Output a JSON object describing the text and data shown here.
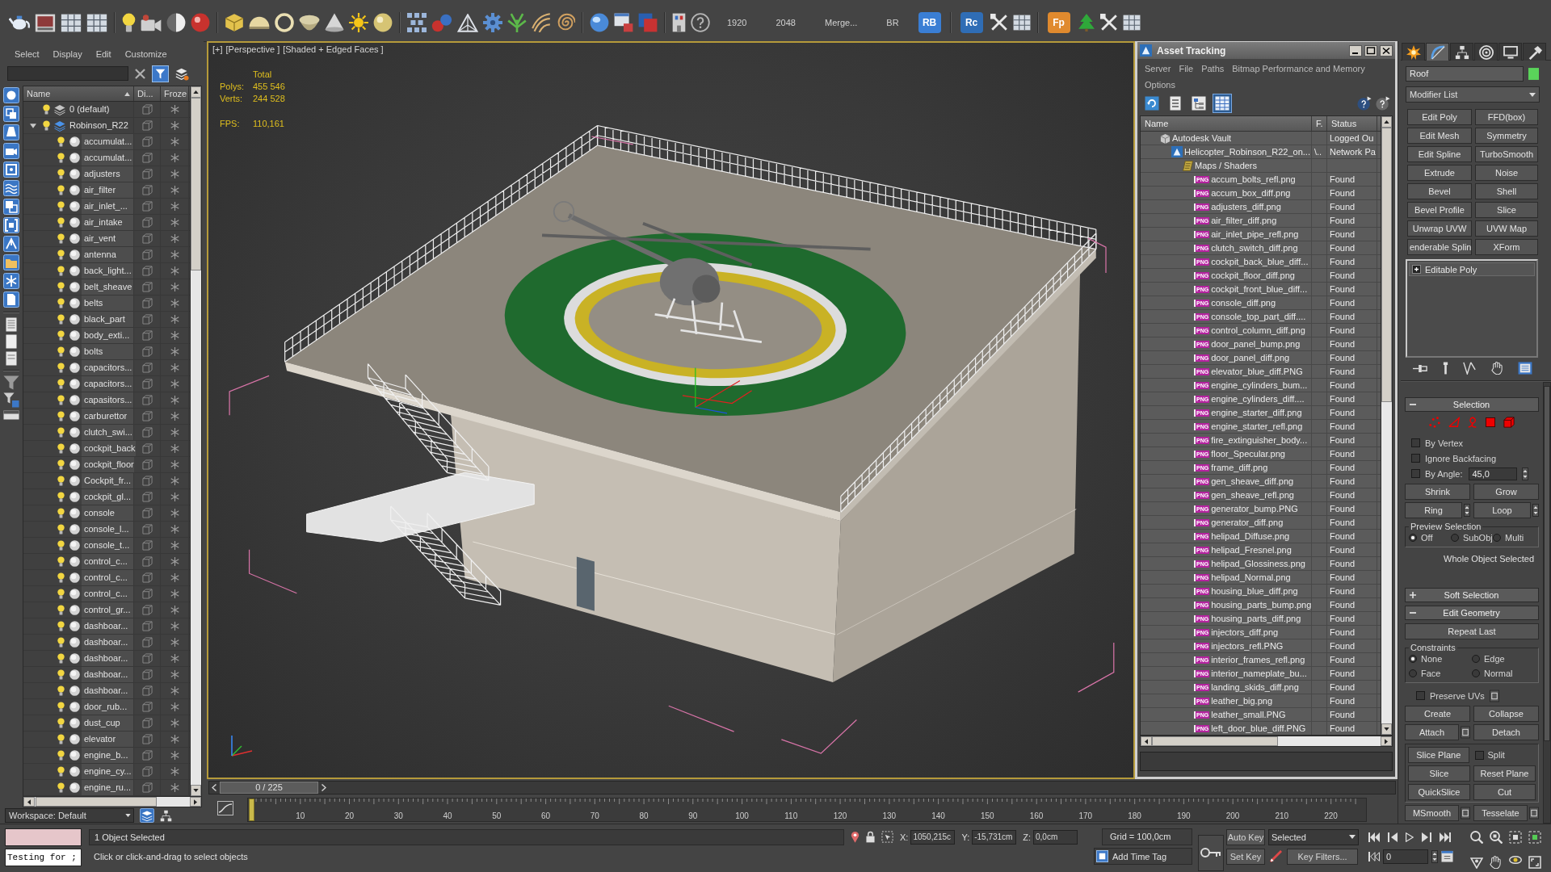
{
  "toolbar": {
    "buttons": [
      {
        "label": "1920",
        "kind": "text"
      },
      {
        "label": "2048",
        "kind": "text"
      },
      {
        "label": "Merge...",
        "kind": "text"
      },
      {
        "label": "BR",
        "kind": "text"
      },
      {
        "label": "RB",
        "kind": "tile",
        "color": "#3a7ed4"
      },
      {
        "label": "Rc",
        "kind": "tile",
        "color": "#2f6db5"
      },
      {
        "label": "Fp",
        "kind": "tile",
        "color": "#e08a2e"
      }
    ]
  },
  "scene_explorer": {
    "menu": [
      "Select",
      "Display",
      "Edit",
      "Customize"
    ],
    "columns": [
      "Name",
      "Di...",
      "Froze"
    ],
    "tree": [
      {
        "name": "0 (default)",
        "kind": "layer",
        "active": false
      },
      {
        "name": "Robinson_R22",
        "kind": "layer",
        "active": true,
        "expanded": true,
        "children": [
          {
            "name": "accumulat...",
            "kind": "object"
          },
          {
            "name": "accumulat...",
            "kind": "object"
          },
          {
            "name": "adjusters",
            "kind": "object"
          },
          {
            "name": "air_filter",
            "kind": "object"
          },
          {
            "name": "air_inlet_...",
            "kind": "object"
          },
          {
            "name": "air_intake",
            "kind": "object"
          },
          {
            "name": "air_vent",
            "kind": "object"
          },
          {
            "name": "antenna",
            "kind": "object"
          },
          {
            "name": "back_light...",
            "kind": "object"
          },
          {
            "name": "belt_sheave",
            "kind": "object"
          },
          {
            "name": "belts",
            "kind": "object"
          },
          {
            "name": "black_part",
            "kind": "object"
          },
          {
            "name": "body_exti...",
            "kind": "object"
          },
          {
            "name": "bolts",
            "kind": "object"
          },
          {
            "name": "capacitors...",
            "kind": "object"
          },
          {
            "name": "capacitors...",
            "kind": "object"
          },
          {
            "name": "capasitors...",
            "kind": "object"
          },
          {
            "name": "carburettor",
            "kind": "object"
          },
          {
            "name": "clutch_swi...",
            "kind": "object"
          },
          {
            "name": "cockpit_back",
            "kind": "object"
          },
          {
            "name": "cockpit_floor",
            "kind": "object"
          },
          {
            "name": "Cockpit_fr...",
            "kind": "object"
          },
          {
            "name": "cockpit_gl...",
            "kind": "object"
          },
          {
            "name": "console",
            "kind": "object"
          },
          {
            "name": "console_l...",
            "kind": "object"
          },
          {
            "name": "console_t...",
            "kind": "object"
          },
          {
            "name": "control_c...",
            "kind": "object"
          },
          {
            "name": "control_c...",
            "kind": "object"
          },
          {
            "name": "control_c...",
            "kind": "object"
          },
          {
            "name": "control_gr...",
            "kind": "object"
          },
          {
            "name": "dashboar...",
            "kind": "object"
          },
          {
            "name": "dashboar...",
            "kind": "object"
          },
          {
            "name": "dashboar...",
            "kind": "object"
          },
          {
            "name": "dashboar...",
            "kind": "object"
          },
          {
            "name": "dashboar...",
            "kind": "object"
          },
          {
            "name": "door_rub...",
            "kind": "object"
          },
          {
            "name": "dust_cup",
            "kind": "object"
          },
          {
            "name": "elevator",
            "kind": "object"
          },
          {
            "name": "engine_b...",
            "kind": "object"
          },
          {
            "name": "engine_cy...",
            "kind": "object"
          },
          {
            "name": "engine_ru...",
            "kind": "object"
          }
        ]
      }
    ],
    "workspace": "Workspace: Default"
  },
  "viewport": {
    "active": true,
    "labels": [
      "[+]",
      "[Perspective ]",
      "[Shaded + Edged Faces ]"
    ],
    "stats": {
      "header": "Total",
      "rows": [
        {
          "label": "Polys:",
          "value": "455 546"
        },
        {
          "label": "Verts:",
          "value": "244 528"
        },
        {
          "label": "FPS:",
          "value": "110,161"
        }
      ]
    }
  },
  "asset_tracking": {
    "title": "Asset Tracking",
    "menu": [
      "Server",
      "File",
      "Paths",
      "Bitmap Performance and Memory",
      "Options"
    ],
    "view_buttons": [
      {
        "selected": false
      },
      {
        "selected": false
      },
      {
        "selected": false
      },
      {
        "selected": true
      }
    ],
    "columns": [
      "Name",
      "F.",
      "Status"
    ],
    "tree": [
      {
        "name": "Autodesk Vault",
        "kind": "vault",
        "status": "Logged Ou",
        "children": [
          {
            "name": "Helicopter_Robinson_R22_on...",
            "kind": "scene",
            "flag": "\\..",
            "status": "Network Pa",
            "children": [
              {
                "name": "Maps / Shaders",
                "kind": "folder",
                "children": [
                  {
                    "name": "accum_bolts_refl.png",
                    "kind": "file",
                    "format": "PNG",
                    "status": "Found"
                  },
                  {
                    "name": "accum_box_diff.png",
                    "kind": "file",
                    "format": "PNG",
                    "status": "Found"
                  },
                  {
                    "name": "adjusters_diff.png",
                    "kind": "file",
                    "format": "PNG",
                    "status": "Found"
                  },
                  {
                    "name": "air_filter_diff.png",
                    "kind": "file",
                    "format": "PNG",
                    "status": "Found"
                  },
                  {
                    "name": "air_inlet_pipe_refl.png",
                    "kind": "file",
                    "format": "PNG",
                    "status": "Found"
                  },
                  {
                    "name": "clutch_switch_diff.png",
                    "kind": "file",
                    "format": "PNG",
                    "status": "Found"
                  },
                  {
                    "name": "cockpit_back_blue_diff...",
                    "kind": "file",
                    "format": "PNG",
                    "status": "Found"
                  },
                  {
                    "name": "cockpit_floor_diff.png",
                    "kind": "file",
                    "format": "PNG",
                    "status": "Found"
                  },
                  {
                    "name": "cockpit_front_blue_diff...",
                    "kind": "file",
                    "format": "PNG",
                    "status": "Found"
                  },
                  {
                    "name": "console_diff.png",
                    "kind": "file",
                    "format": "PNG",
                    "status": "Found"
                  },
                  {
                    "name": "console_top_part_diff....",
                    "kind": "file",
                    "format": "PNG",
                    "status": "Found"
                  },
                  {
                    "name": "control_column_diff.png",
                    "kind": "file",
                    "format": "PNG",
                    "status": "Found"
                  },
                  {
                    "name": "door_panel_bump.png",
                    "kind": "file",
                    "format": "PNG",
                    "status": "Found"
                  },
                  {
                    "name": "door_panel_diff.png",
                    "kind": "file",
                    "format": "PNG",
                    "status": "Found"
                  },
                  {
                    "name": "elevator_blue_diff.PNG",
                    "kind": "file",
                    "format": "PNG",
                    "status": "Found"
                  },
                  {
                    "name": "engine_cylinders_bum...",
                    "kind": "file",
                    "format": "PNG",
                    "status": "Found"
                  },
                  {
                    "name": "engine_cylinders_diff....",
                    "kind": "file",
                    "format": "PNG",
                    "status": "Found"
                  },
                  {
                    "name": "engine_starter_diff.png",
                    "kind": "file",
                    "format": "PNG",
                    "status": "Found"
                  },
                  {
                    "name": "engine_starter_refl.png",
                    "kind": "file",
                    "format": "PNG",
                    "status": "Found"
                  },
                  {
                    "name": "fire_extinguisher_body...",
                    "kind": "file",
                    "format": "PNG",
                    "status": "Found"
                  },
                  {
                    "name": "floor_Specular.png",
                    "kind": "file",
                    "format": "PNG",
                    "status": "Found"
                  },
                  {
                    "name": "frame_diff.png",
                    "kind": "file",
                    "format": "PNG",
                    "status": "Found"
                  },
                  {
                    "name": "gen_sheave_diff.png",
                    "kind": "file",
                    "format": "PNG",
                    "status": "Found"
                  },
                  {
                    "name": "gen_sheave_refl.png",
                    "kind": "file",
                    "format": "PNG",
                    "status": "Found"
                  },
                  {
                    "name": "generator_bump.PNG",
                    "kind": "file",
                    "format": "PNG",
                    "status": "Found"
                  },
                  {
                    "name": "generator_diff.png",
                    "kind": "file",
                    "format": "PNG",
                    "status": "Found"
                  },
                  {
                    "name": "helipad_Diffuse.png",
                    "kind": "file",
                    "format": "PNG",
                    "status": "Found"
                  },
                  {
                    "name": "helipad_Fresnel.png",
                    "kind": "file",
                    "format": "PNG",
                    "status": "Found"
                  },
                  {
                    "name": "helipad_Glossiness.png",
                    "kind": "file",
                    "format": "PNG",
                    "status": "Found"
                  },
                  {
                    "name": "helipad_Normal.png",
                    "kind": "file",
                    "format": "PNG",
                    "status": "Found"
                  },
                  {
                    "name": "housing_blue_diff.png",
                    "kind": "file",
                    "format": "PNG",
                    "status": "Found"
                  },
                  {
                    "name": "housing_parts_bump.png",
                    "kind": "file",
                    "format": "PNG",
                    "status": "Found"
                  },
                  {
                    "name": "housing_parts_diff.png",
                    "kind": "file",
                    "format": "PNG",
                    "status": "Found"
                  },
                  {
                    "name": "injectors_diff.png",
                    "kind": "file",
                    "format": "PNG",
                    "status": "Found"
                  },
                  {
                    "name": "injectors_refl.PNG",
                    "kind": "file",
                    "format": "PNG",
                    "status": "Found"
                  },
                  {
                    "name": "interior_frames_refl.png",
                    "kind": "file",
                    "format": "PNG",
                    "status": "Found"
                  },
                  {
                    "name": "interior_nameplate_bu...",
                    "kind": "file",
                    "format": "PNG",
                    "status": "Found"
                  },
                  {
                    "name": "landing_skids_diff.png",
                    "kind": "file",
                    "format": "PNG",
                    "status": "Found"
                  },
                  {
                    "name": "leather_big.png",
                    "kind": "file",
                    "format": "PNG",
                    "status": "Found"
                  },
                  {
                    "name": "leather_small.PNG",
                    "kind": "file",
                    "format": "PNG",
                    "status": "Found"
                  },
                  {
                    "name": "left_door_blue_diff.PNG",
                    "kind": "file",
                    "format": "PNG",
                    "status": "Found"
                  }
                ]
              }
            ]
          }
        ]
      }
    ]
  },
  "time_slider": {
    "label": "0 / 225",
    "level": 0
  },
  "track_bar": {
    "ticks": [
      "10",
      "20",
      "30",
      "40",
      "50",
      "60",
      "70",
      "80",
      "90",
      "100",
      "110",
      "120",
      "130",
      "140",
      "150",
      "160",
      "170",
      "180",
      "190",
      "200",
      "210",
      "220"
    ]
  },
  "command_panel": {
    "tabs": [
      {
        "selected": false
      },
      {
        "selected": true
      },
      {
        "selected": false
      },
      {
        "selected": false
      },
      {
        "selected": false
      },
      {
        "selected": false
      }
    ],
    "object_name": "Roof",
    "modifier_list": "Modifier List",
    "modifiers": [
      "Edit Poly",
      "FFD(box)",
      "Edit Mesh",
      "Symmetry",
      "Edit Spline",
      "TurboSmooth",
      "Extrude",
      "Noise",
      "Bevel",
      "Shell",
      "Bevel Profile",
      "Slice",
      "Unwrap UVW",
      "UVW Map",
      "enderable Splin",
      "XForm"
    ],
    "stack": [
      {
        "name": "Editable Poly",
        "expanded": false
      }
    ],
    "selection": {
      "title": "Selection",
      "expanded": true,
      "checkboxes": [
        {
          "label": "By Vertex",
          "checked": false
        },
        {
          "label": "Ignore Backfacing",
          "checked": false
        },
        {
          "label": "By Angle:",
          "checked": false,
          "value": "45,0"
        }
      ],
      "rows": [
        [
          {
            "kind": "button",
            "label": "Shrink"
          },
          {
            "kind": "button",
            "label": "Grow"
          }
        ],
        [
          {
            "kind": "spinner",
            "label": "Ring"
          },
          {
            "kind": "spinner",
            "label": "Loop"
          }
        ]
      ],
      "preview": {
        "title": "Preview Selection",
        "options": [
          {
            "label": "Off",
            "selected": true
          },
          {
            "label": "SubObj",
            "selected": false
          },
          {
            "label": "Multi",
            "selected": false
          }
        ]
      },
      "status": "Whole Object Selected"
    },
    "soft_selection": {
      "title": "Soft Selection",
      "expanded": false
    },
    "edit_geometry": {
      "title": "Edit Geometry",
      "expanded": true,
      "repeat": "Repeat Last",
      "constraints": {
        "title": "Constraints",
        "options": [
          {
            "label": "None",
            "selected": true
          },
          {
            "label": "Edge",
            "selected": false
          },
          {
            "label": "Face",
            "selected": false
          },
          {
            "label": "Normal",
            "selected": false
          }
        ]
      },
      "preserve_uvs": {
        "label": "Preserve UVs",
        "checked": false
      },
      "groups": [
        {
          "framed": false,
          "rows": [
            [
              {
                "kind": "button",
                "label": "Create"
              },
              {
                "kind": "button",
                "label": "Collapse"
              }
            ],
            [
              {
                "kind": "settings",
                "label": "Attach"
              },
              {
                "kind": "button",
                "label": "Detach"
              }
            ]
          ]
        },
        {
          "framed": true,
          "rows": [
            [
              {
                "kind": "button",
                "label": "Slice Plane"
              },
              {
                "kind": "checkbox",
                "label": "Split",
                "checked": false
              }
            ],
            [
              {
                "kind": "button",
                "label": "Slice"
              },
              {
                "kind": "button",
                "label": "Reset Plane"
              }
            ],
            [
              {
                "kind": "button",
                "label": "QuickSlice"
              },
              {
                "kind": "button",
                "label": "Cut"
              }
            ]
          ]
        },
        {
          "framed": false,
          "rows": [
            [
              {
                "kind": "settings",
                "label": "MSmooth"
              },
              {
                "kind": "settings",
                "label": "Tesselate"
              }
            ]
          ]
        }
      ]
    }
  },
  "status_bar": {
    "listener": "Testing for ;",
    "selection": "1 Object Selected",
    "prompt": "Click or click-and-drag to select objects",
    "coords": [
      {
        "axis": "X:",
        "value": "1050,215c"
      },
      {
        "axis": "Y:",
        "value": "-15,731cm"
      },
      {
        "axis": "Z:",
        "value": "0,0cm"
      }
    ],
    "grid": "Grid = 100,0cm",
    "time_tag": "Add Time Tag",
    "auto_key": {
      "label": "Auto Key",
      "on": false
    },
    "set_key": "Set Key",
    "key_mode": "Selected",
    "key_filters": "Key Filters...",
    "frame": "0"
  }
}
